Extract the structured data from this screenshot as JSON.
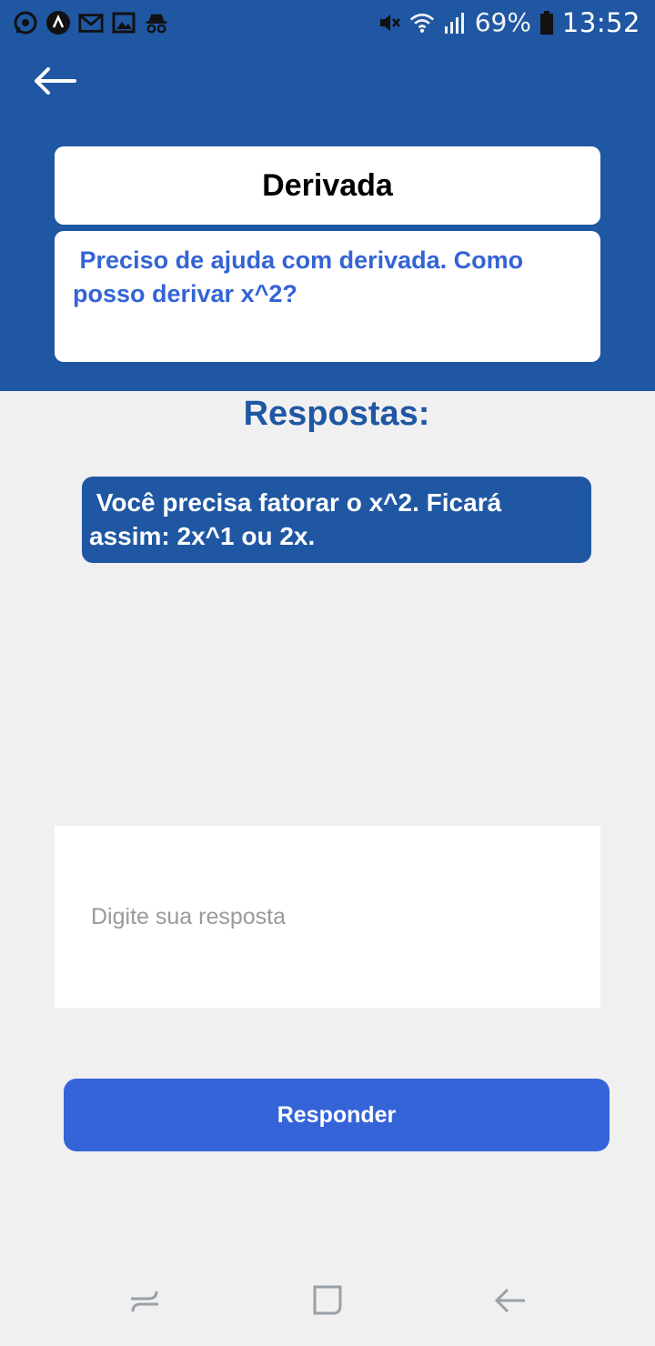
{
  "status_bar": {
    "battery": "69%",
    "time": "13:52",
    "left_icons": [
      "whatsapp-icon",
      "app-icon",
      "gmail-icon",
      "image-icon",
      "incognito-icon"
    ],
    "right_icons": [
      "mute-icon",
      "wifi-icon",
      "signal-icon",
      "battery-icon"
    ]
  },
  "header": {
    "back_icon": "arrow-left-icon"
  },
  "question": {
    "title": "Derivada",
    "body": " Preciso de ajuda com derivada. Como\nposso derivar x^2?"
  },
  "answers": {
    "heading": "Respostas:",
    "items": [
      {
        "text": " Você precisa fatorar o x^2. Ficará\nassim: 2x^1 ou 2x."
      }
    ]
  },
  "reply": {
    "placeholder": "Digite sua resposta",
    "value": "",
    "button_label": "Responder"
  },
  "nav_bar": {
    "icons": [
      "recent-apps-icon",
      "home-icon",
      "back-icon"
    ]
  },
  "colors": {
    "header_bg": "#1f57a3",
    "accent_button": "#3464d8",
    "question_text": "#3464d4",
    "page_bg": "#f0f0f0"
  }
}
